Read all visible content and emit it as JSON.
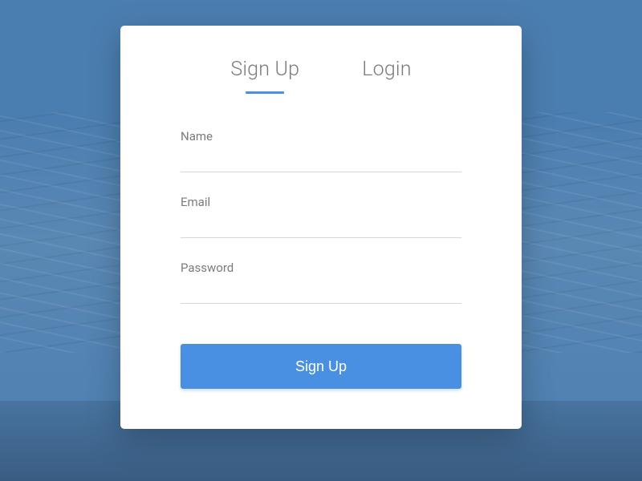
{
  "tabs": {
    "signup": "Sign Up",
    "login": "Login"
  },
  "fields": {
    "name": {
      "label": "Name",
      "value": ""
    },
    "email": {
      "label": "Email",
      "value": ""
    },
    "password": {
      "label": "Password",
      "value": ""
    }
  },
  "submit_label": "Sign Up",
  "colors": {
    "accent": "#4a90e2",
    "background": "#4b7eb0"
  }
}
